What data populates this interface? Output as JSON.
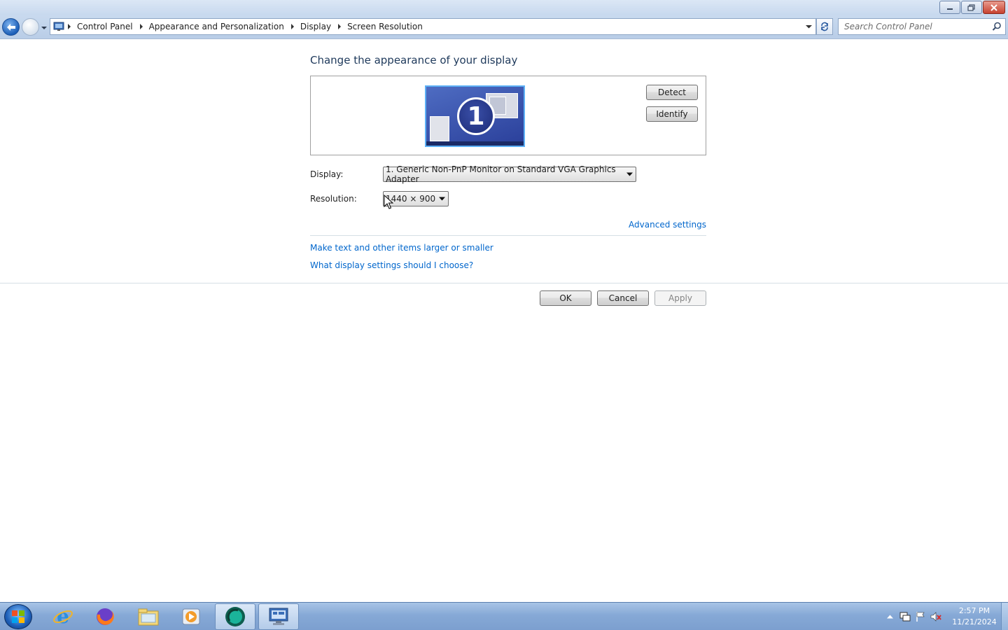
{
  "window": {
    "minimize_icon": "minimize-icon",
    "restore_icon": "restore-icon",
    "close_icon": "close-icon"
  },
  "address": {
    "root_icon": "control-panel-icon",
    "breadcrumbs": [
      "Control Panel",
      "Appearance and Personalization",
      "Display",
      "Screen Resolution"
    ]
  },
  "search": {
    "placeholder": "Search Control Panel"
  },
  "main": {
    "heading": "Change the appearance of your display",
    "monitor_number": "1",
    "detect_label": "Detect",
    "identify_label": "Identify",
    "display_label": "Display:",
    "display_value": "1. Generic Non-PnP Monitor on Standard VGA Graphics Adapter",
    "resolution_label": "Resolution:",
    "resolution_value": "1440 × 900",
    "advanced_link": "Advanced settings",
    "link_text_size": "Make text and other items larger or smaller",
    "link_help": "What display settings should I choose?",
    "ok_label": "OK",
    "cancel_label": "Cancel",
    "apply_label": "Apply"
  },
  "taskbar": {
    "pinned": [
      "internet-explorer-icon",
      "firefox-icon",
      "file-explorer-icon",
      "media-player-icon",
      "app-icon",
      "control-panel-icon"
    ],
    "time": "2:57 PM",
    "date": "11/21/2024"
  },
  "colors": {
    "heading": "#1e395b",
    "link": "#0066cc",
    "chrome": "#c9daef"
  }
}
